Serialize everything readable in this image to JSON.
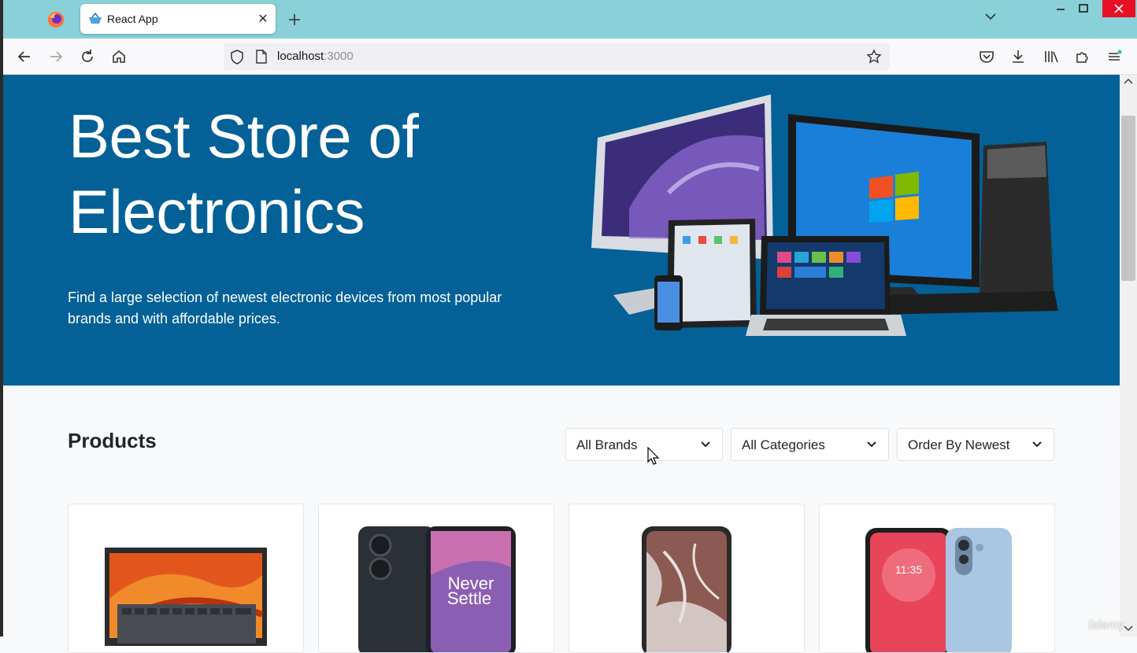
{
  "browser": {
    "tab_title": "React App",
    "url_host": "localhost",
    "url_port": ":3000"
  },
  "hero": {
    "title_line1": "Best Store of",
    "title_line2": "Electronics",
    "description": "Find a large selection of newest electronic devices from most popular brands and with affordable prices."
  },
  "products": {
    "title": "Products",
    "brand_filter": "All Brands",
    "category_filter": "All Categories",
    "sort_order": "Order By Newest",
    "cards": [
      {
        "image": "laptop"
      },
      {
        "image": "oneplus-phone",
        "caption_line1": "Never",
        "caption_line2": "Settle"
      },
      {
        "image": "pixel-phone"
      },
      {
        "image": "motorola-phone",
        "time": "11:35"
      }
    ]
  },
  "colors": {
    "hero_bg": "#036198",
    "tabbar_bg": "#8ad0d8"
  },
  "watermark": "ûdemy"
}
